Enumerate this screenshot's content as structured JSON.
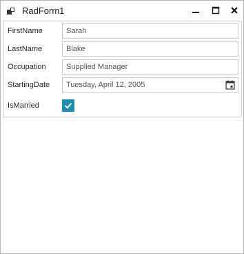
{
  "window": {
    "title": "RadForm1",
    "icon": "radform-app-icon",
    "controls": {
      "minimize_icon": "minimize-icon",
      "maximize_icon": "maximize-icon",
      "close_icon": "close-icon"
    }
  },
  "form": {
    "first_name": {
      "label": "FirstName",
      "value": "Sarah"
    },
    "last_name": {
      "label": "LastName",
      "value": "Blake"
    },
    "occupation": {
      "label": "Occupation",
      "value": "Supplied Manager"
    },
    "starting_date": {
      "label": "StartingDate",
      "value": "Tuesday, April 12, 2005",
      "icon": "calendar-icon"
    },
    "is_married": {
      "label": "IsMarried",
      "checked": true
    }
  },
  "colors": {
    "accent": "#1c8fb1",
    "border": "#c8c8c8"
  }
}
